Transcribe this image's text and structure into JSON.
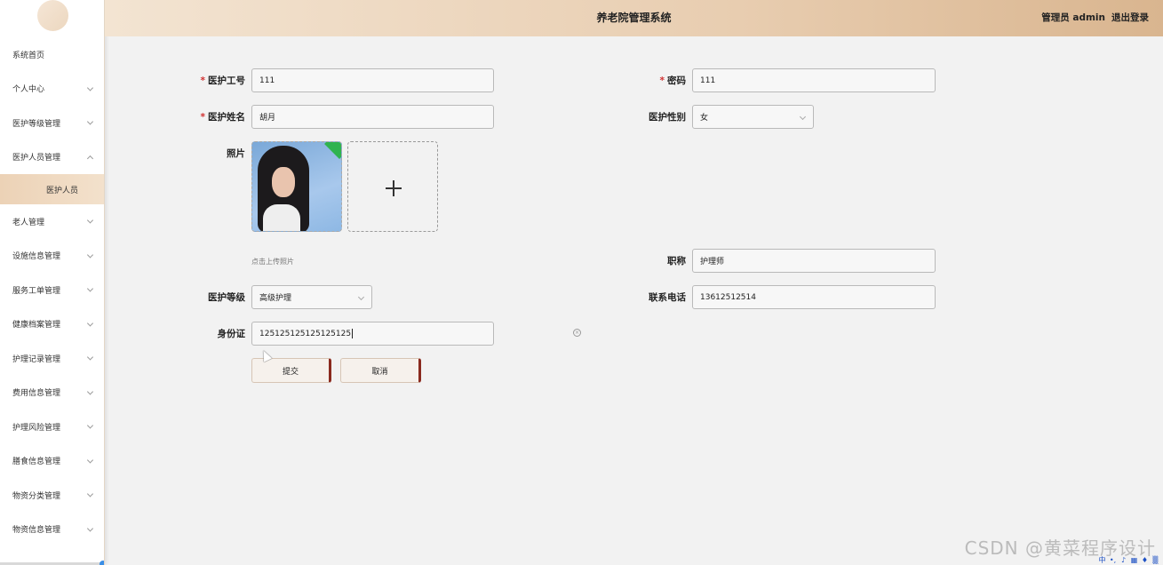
{
  "header": {
    "title": "养老院管理系统",
    "user": "管理员 admin",
    "logout": "退出登录"
  },
  "sidebar": {
    "items": [
      {
        "label": "系统首页",
        "expandable": false
      },
      {
        "label": "个人中心",
        "expandable": true
      },
      {
        "label": "医护等级管理",
        "expandable": true
      },
      {
        "label": "医护人员管理",
        "expandable": true,
        "expanded": true
      },
      {
        "label": "老人管理",
        "expandable": true
      },
      {
        "label": "设施信息管理",
        "expandable": true
      },
      {
        "label": "服务工单管理",
        "expandable": true
      },
      {
        "label": "健康档案管理",
        "expandable": true
      },
      {
        "label": "护理记录管理",
        "expandable": true
      },
      {
        "label": "费用信息管理",
        "expandable": true
      },
      {
        "label": "护理风险管理",
        "expandable": true
      },
      {
        "label": "膳食信息管理",
        "expandable": true
      },
      {
        "label": "物资分类管理",
        "expandable": true
      },
      {
        "label": "物资信息管理",
        "expandable": true
      }
    ],
    "subitem": "医护人员"
  },
  "form": {
    "staff_id": {
      "label": "医护工号",
      "value": "111",
      "required": "*"
    },
    "password": {
      "label": "密码",
      "value": "111",
      "required": "*"
    },
    "name": {
      "label": "医护姓名",
      "value": "胡月",
      "required": "*"
    },
    "gender": {
      "label": "医护性别",
      "value": "女"
    },
    "photo": {
      "label": "照片",
      "hint": "点击上传照片"
    },
    "title": {
      "label": "职称",
      "value": "护理师"
    },
    "level": {
      "label": "医护等级",
      "value": "高级护理"
    },
    "phone": {
      "label": "联系电话",
      "value": "13612512514"
    },
    "id_card": {
      "label": "身份证",
      "value": "125125125125125125"
    },
    "submit": "提交",
    "cancel": "取消"
  },
  "watermark": "CSDN @黄菜程序设计",
  "tray_icons": [
    "中",
    "•,",
    "mic-icon",
    "keyboard-icon",
    "shirt-icon",
    "grid-icon"
  ]
}
